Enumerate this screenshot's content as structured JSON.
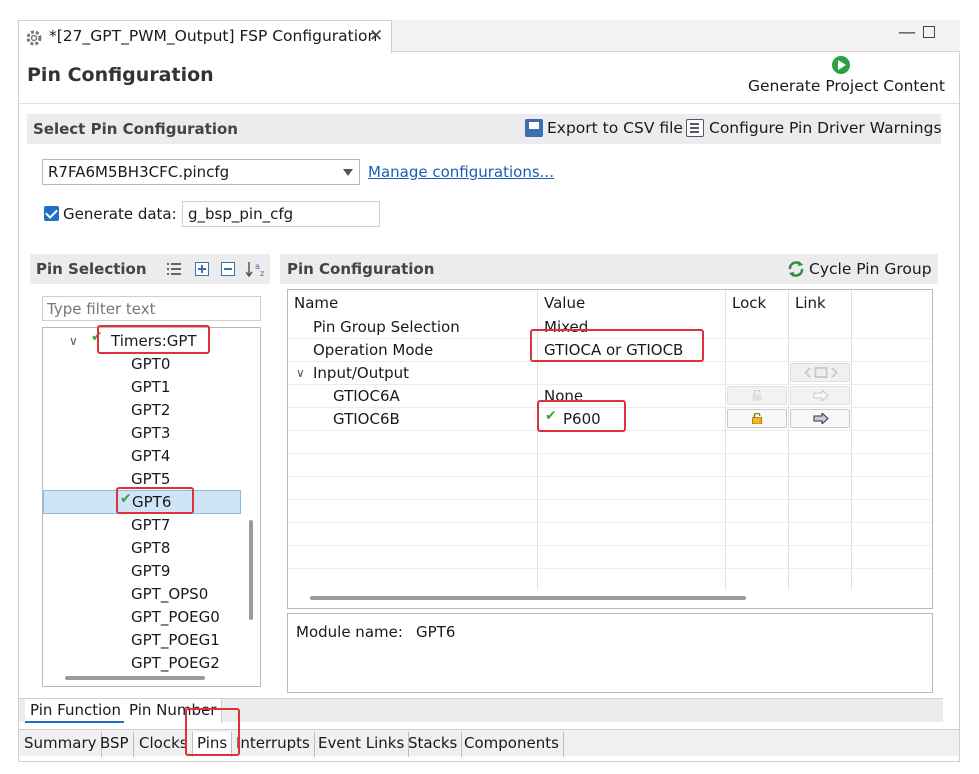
{
  "tab": {
    "title": "*[27_GPT_PWM_Output] FSP Configuration",
    "close": "✕"
  },
  "window": {
    "minimize": "—"
  },
  "header": {
    "title": "Pin Configuration",
    "generate_label": "Generate Project Content"
  },
  "select_pin_config": {
    "title": "Select Pin Configuration",
    "export_csv": "Export to CSV file",
    "configure_warnings": "Configure Pin Driver Warnings",
    "config_file": "R7FA6M5BH3CFC.pincfg",
    "manage_link": "Manage configurations...",
    "generate_data_label": "Generate data:",
    "generate_data_value": "g_bsp_pin_cfg",
    "generate_data_checked": true
  },
  "pin_selection": {
    "title": "Pin Selection",
    "filter_placeholder": "Type filter text",
    "group": {
      "label": "Timers:GPT",
      "checked": true,
      "expanded": true
    },
    "items": [
      {
        "label": "GPT0"
      },
      {
        "label": "GPT1"
      },
      {
        "label": "GPT2"
      },
      {
        "label": "GPT3"
      },
      {
        "label": "GPT4"
      },
      {
        "label": "GPT5"
      },
      {
        "label": "GPT6",
        "selected": true,
        "checked": true
      },
      {
        "label": "GPT7"
      },
      {
        "label": "GPT8"
      },
      {
        "label": "GPT9"
      },
      {
        "label": "GPT_OPS0"
      },
      {
        "label": "GPT_POEG0"
      },
      {
        "label": "GPT_POEG1"
      },
      {
        "label": "GPT_POEG2"
      }
    ]
  },
  "pin_configuration": {
    "title": "Pin Configuration",
    "cycle_label": "Cycle Pin Group",
    "columns": {
      "name": "Name",
      "value": "Value",
      "lock": "Lock",
      "link": "Link"
    },
    "rows": {
      "pin_group_selection": {
        "name": "Pin Group Selection",
        "value": "Mixed"
      },
      "operation_mode": {
        "name": "Operation Mode",
        "value": "GTIOCA or GTIOCB"
      },
      "input_output": {
        "name": "Input/Output"
      },
      "gtioc6a": {
        "name": "GTIOC6A",
        "value": "None"
      },
      "gtioc6b": {
        "name": "GTIOC6B",
        "value": "P600"
      }
    },
    "module_label": "Module name:",
    "module_value": "GPT6"
  },
  "pin_tabs": {
    "function": "Pin Function",
    "number": "Pin Number"
  },
  "config_tabs": [
    "Summary",
    "BSP",
    "Clocks",
    "Pins",
    "Interrupts",
    "Event Links",
    "Stacks",
    "Components"
  ],
  "colors": {
    "accent": "#1f6fc7",
    "annotation": "#e0303a",
    "check": "#3aa336"
  }
}
